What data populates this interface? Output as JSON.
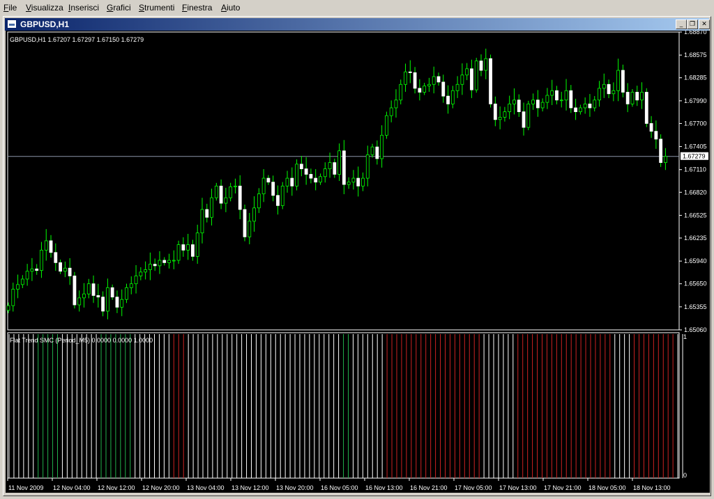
{
  "menu": [
    "File",
    "Visualizza",
    "Inserisci",
    "Grafici",
    "Strumenti",
    "Finestra",
    "Aiuto"
  ],
  "window": {
    "title": "GBPUSD,H1"
  },
  "chart_data": {
    "type": "candlestick",
    "symbol_info": "GBPUSD,H1  1.67207 1.67297 1.67150 1.67279",
    "price_ticks": [
      "1.68870",
      "1.68575",
      "1.68285",
      "1.67990",
      "1.67700",
      "1.67405",
      "1.67110",
      "1.66820",
      "1.66525",
      "1.66235",
      "1.65940",
      "1.65650",
      "1.65355",
      "1.65060"
    ],
    "current_price": "1.67279",
    "ylim": [
      1.6506,
      1.6887
    ],
    "time_labels": [
      "11 Nov 2009",
      "12 Nov 04:00",
      "12 Nov 12:00",
      "12 Nov 20:00",
      "13 Nov 04:00",
      "13 Nov 12:00",
      "13 Nov 20:00",
      "16 Nov 05:00",
      "16 Nov 13:00",
      "16 Nov 21:00",
      "17 Nov 05:00",
      "17 Nov 13:00",
      "17 Nov 21:00",
      "18 Nov 05:00",
      "18 Nov 13:00"
    ],
    "closes": [
      1.6537,
      1.6558,
      1.6564,
      1.6571,
      1.6581,
      1.6584,
      1.6582,
      1.6608,
      1.662,
      1.6605,
      1.6592,
      1.6581,
      1.6585,
      1.6575,
      1.6538,
      1.6547,
      1.6552,
      1.6565,
      1.655,
      1.6548,
      1.653,
      1.656,
      1.6548,
      1.6535,
      1.6545,
      1.656,
      1.6565,
      1.6575,
      1.658,
      1.6583,
      1.659,
      1.6588,
      1.6595,
      1.6592,
      1.6595,
      1.6595,
      1.6615,
      1.6608,
      1.6615,
      1.66,
      1.663,
      1.666,
      1.665,
      1.6675,
      1.669,
      1.6668,
      1.6675,
      1.6689,
      1.669,
      1.666,
      1.6625,
      1.6645,
      1.6662,
      1.668,
      1.67,
      1.6695,
      1.6678,
      1.6665,
      1.669,
      1.67,
      1.669,
      1.6718,
      1.6712,
      1.6705,
      1.67,
      1.6695,
      1.6702,
      1.6712,
      1.672,
      1.6705,
      1.6735,
      1.6692,
      1.6695,
      1.67,
      1.669,
      1.67,
      1.673,
      1.674,
      1.6725,
      1.6755,
      1.678,
      1.679,
      1.68,
      1.682,
      1.6836,
      1.6835,
      1.6815,
      1.681,
      1.6818,
      1.682,
      1.683,
      1.6823,
      1.6805,
      1.6795,
      1.6812,
      1.682,
      1.6832,
      1.684,
      1.6813,
      1.685,
      1.6838,
      1.6853,
      1.6795,
      1.6775,
      1.6778,
      1.6785,
      1.6795,
      1.68,
      1.6785,
      1.6765,
      1.6795,
      1.68,
      1.679,
      1.6797,
      1.6806,
      1.6812,
      1.68,
      1.68,
      1.6812,
      1.679,
      1.6785,
      1.679,
      1.6795,
      1.679,
      1.68,
      1.6815,
      1.682,
      1.6808,
      1.6812,
      1.6838,
      1.681,
      1.6795,
      1.681,
      1.68,
      1.681,
      1.677,
      1.676,
      1.675,
      1.672,
      1.6728
    ],
    "indicator": {
      "label": "Flat Trend SMC (Period_M5) 0.0000 0.0000 1.0000",
      "scale_top": "1",
      "scale_bottom": "0",
      "bar_colors": [
        "#ffffff",
        "#ffffff",
        "#ffffff",
        "#ffffff",
        "#ffffff",
        "#ffffff",
        "#22b14c",
        "#22b14c",
        "#22b14c",
        "#22b14c",
        "#22b14c",
        "#ffffff",
        "#ffffff",
        "#ffffff",
        "#ffffff",
        "#ffffff",
        "#ffffff",
        "#ffffff",
        "#ffffff",
        "#22b14c",
        "#22b14c",
        "#22b14c",
        "#22b14c",
        "#22b14c",
        "#22b14c",
        "#22b14c",
        "#ffffff",
        "#ffffff",
        "#ffffff",
        "#ffffff",
        "#ffffff",
        "#ffffff",
        "#ffffff",
        "#ffffff",
        "#cc2222",
        "#cc2222",
        "#cc2222",
        "#ffffff",
        "#ffffff",
        "#ffffff",
        "#ffffff",
        "#ffffff",
        "#ffffff",
        "#ffffff",
        "#ffffff",
        "#ffffff",
        "#ffffff",
        "#ffffff",
        "#ffffff",
        "#ffffff",
        "#ffffff",
        "#ffffff",
        "#ffffff",
        "#ffffff",
        "#ffffff",
        "#ffffff",
        "#ffffff",
        "#ffffff",
        "#ffffff",
        "#ffffff",
        "#ffffff",
        "#ffffff",
        "#ffffff",
        "#ffffff",
        "#ffffff",
        "#ffffff",
        "#ffffff",
        "#ffffff",
        "#ffffff",
        "#22b14c",
        "#22b14c",
        "#ffffff",
        "#ffffff",
        "#ffffff",
        "#ffffff",
        "#ffffff",
        "#ffffff",
        "#ffffff",
        "#cc2222",
        "#cc2222",
        "#cc2222",
        "#cc2222",
        "#cc2222",
        "#cc2222",
        "#cc2222",
        "#cc2222",
        "#cc2222",
        "#cc2222",
        "#cc2222",
        "#cc2222",
        "#cc2222",
        "#cc2222",
        "#cc2222",
        "#cc2222",
        "#cc2222",
        "#cc2222",
        "#cc2222",
        "#cc2222",
        "#ffffff",
        "#ffffff",
        "#ffffff",
        "#ffffff",
        "#ffffff",
        "#ffffff",
        "#ffffff",
        "#cc2222",
        "#cc2222",
        "#cc2222",
        "#cc2222",
        "#cc2222",
        "#cc2222",
        "#cc2222",
        "#cc2222",
        "#cc2222",
        "#cc2222",
        "#cc2222",
        "#cc2222",
        "#cc2222",
        "#cc2222",
        "#cc2222",
        "#cc2222",
        "#cc2222",
        "#cc2222",
        "#cc2222",
        "#cc2222",
        "#ffffff",
        "#ffffff",
        "#ffffff",
        "#ffffff",
        "#cc2222",
        "#cc2222",
        "#cc2222",
        "#cc2222",
        "#cc2222",
        "#cc2222",
        "#cc2222",
        "#cc2222",
        "#cc2222",
        "#ffffff",
        "#ffffff"
      ]
    }
  }
}
